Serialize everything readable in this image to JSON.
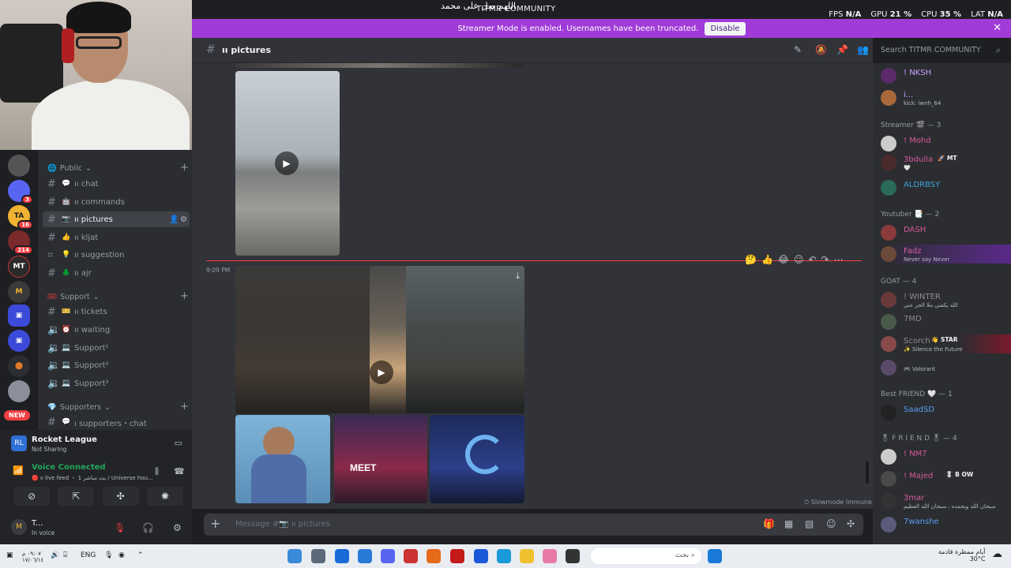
{
  "titlebar": {
    "app_title": "TITMR COMMUNITY",
    "overlay_text": "اللهم صل على محمد",
    "fps_label": "FPS",
    "fps_value": "N/A",
    "gpu_label": "GPU",
    "gpu_value": "21 %",
    "cpu_label": "CPU",
    "cpu_value": "35 %",
    "lat_label": "LAT",
    "lat_value": "N/A"
  },
  "banner": {
    "text": "Streamer Mode is enabled. Usernames have been truncated.",
    "button": "Disable"
  },
  "rail": {
    "badges": [
      "3",
      "16",
      "214"
    ],
    "new_label": "NEW"
  },
  "categories": [
    {
      "label": "Public"
    },
    {
      "label": "Support"
    },
    {
      "label": "Supporters"
    }
  ],
  "channels": [
    {
      "label": "ıı chat",
      "emoji": "💬"
    },
    {
      "label": "ıı commands",
      "emoji": "🤖"
    },
    {
      "label": "ıı pictures",
      "emoji": "📷"
    },
    {
      "label": "ıı kljat",
      "emoji": "👍"
    },
    {
      "label": "ıı suggestion",
      "emoji": "💡"
    },
    {
      "label": "ıı ajr",
      "emoji": "🌲"
    },
    {
      "label": "ıı tickets",
      "emoji": "🎫"
    },
    {
      "label": "ıı waiting",
      "emoji": "⏰"
    },
    {
      "label": "Support¹",
      "emoji": "🔈"
    },
    {
      "label": "Support²",
      "emoji": "🔈"
    },
    {
      "label": "Support³",
      "emoji": "🔈"
    },
    {
      "label": "ı supporters・chat",
      "emoji": "💬"
    }
  ],
  "activity": {
    "game": "Rocket League",
    "status": "Not Sharing"
  },
  "voice": {
    "title": "Voice Connected",
    "subtitle": "🔴 ıı live feed ・ 1 بث مباشر / Universe hou..."
  },
  "user": {
    "name": "T...",
    "status": "In voice"
  },
  "chat_header": {
    "channel": "ıı pictures"
  },
  "search": {
    "placeholder": "Search TITMR COMMUNITY"
  },
  "chat": {
    "timestamp": "9:09 PM",
    "slowmode": "Slowmode Immune",
    "composer_placeholder": "Message #📷 ıı pictures"
  },
  "members": {
    "top": [
      {
        "name": "! NKSH",
        "status": "",
        "color": "#c7a0ff"
      },
      {
        "name": "i...",
        "status": "kick: iwnh_64",
        "color": "#c7a0ff"
      }
    ],
    "groups": [
      {
        "label": "Streamer 🎬 — 3",
        "items": [
          {
            "name": "! Mohd",
            "status": "",
            "color": "#d65a9a"
          },
          {
            "name": "3bdulla",
            "status": "🤍",
            "color": "#d65a9a",
            "tag": "🚀 MT"
          },
          {
            "name": "ALDRBSY",
            "status": "",
            "color": "#3ea8d6"
          }
        ]
      },
      {
        "label": "Youtuber 📑 — 2",
        "items": [
          {
            "name": "DASH",
            "status": "",
            "color": "#d65a9a"
          },
          {
            "name": "Fadz",
            "status": "Never say Never",
            "color": "#d65a9a"
          }
        ]
      },
      {
        "label": "GOAT — 4",
        "items": [
          {
            "name": "! WINTER",
            "status": "الله يكفني ملا الحر عني",
            "color": "#8e8e8e"
          },
          {
            "name": "7MD",
            "status": "",
            "color": "#8e8e8e"
          },
          {
            "name": "Scorch",
            "status": "✨ Silence the Future",
            "color": "#8e8e8e",
            "tag": "👋 STAR"
          },
          {
            "name": "",
            "status": "🎮 Valorant",
            "color": "#8e8e8e"
          }
        ]
      },
      {
        "label": "Best FRIEND 🤍 — 1",
        "items": [
          {
            "name": "SaadSD",
            "status": "",
            "color": "#5b9cf2"
          }
        ]
      },
      {
        "label": "🎖 F R I E N D 🎖 — 4",
        "items": [
          {
            "name": "! NM7",
            "status": "",
            "color": "#d65a9a"
          },
          {
            "name": "! Majed",
            "status": "",
            "color": "#d65a9a",
            "tag": "🎖 B OW"
          },
          {
            "name": "3mar",
            "status": "سبحان الله وبحمده ، سبحان الله العظيم",
            "color": "#d65a9a"
          },
          {
            "name": "7wanshe",
            "status": "",
            "color": "#5b9cf2"
          }
        ]
      }
    ]
  },
  "taskbar": {
    "lang": "ENG",
    "search": "بحث",
    "date": "١٧/٠٦/١٤",
    "time": "٠٩:٠٧ م",
    "weather": "أيام ممطرة قادمة",
    "temp": "30°C"
  },
  "colors": {
    "banner": "#a03bd8",
    "online": "#23a55a",
    "danger": "#f23f43"
  }
}
